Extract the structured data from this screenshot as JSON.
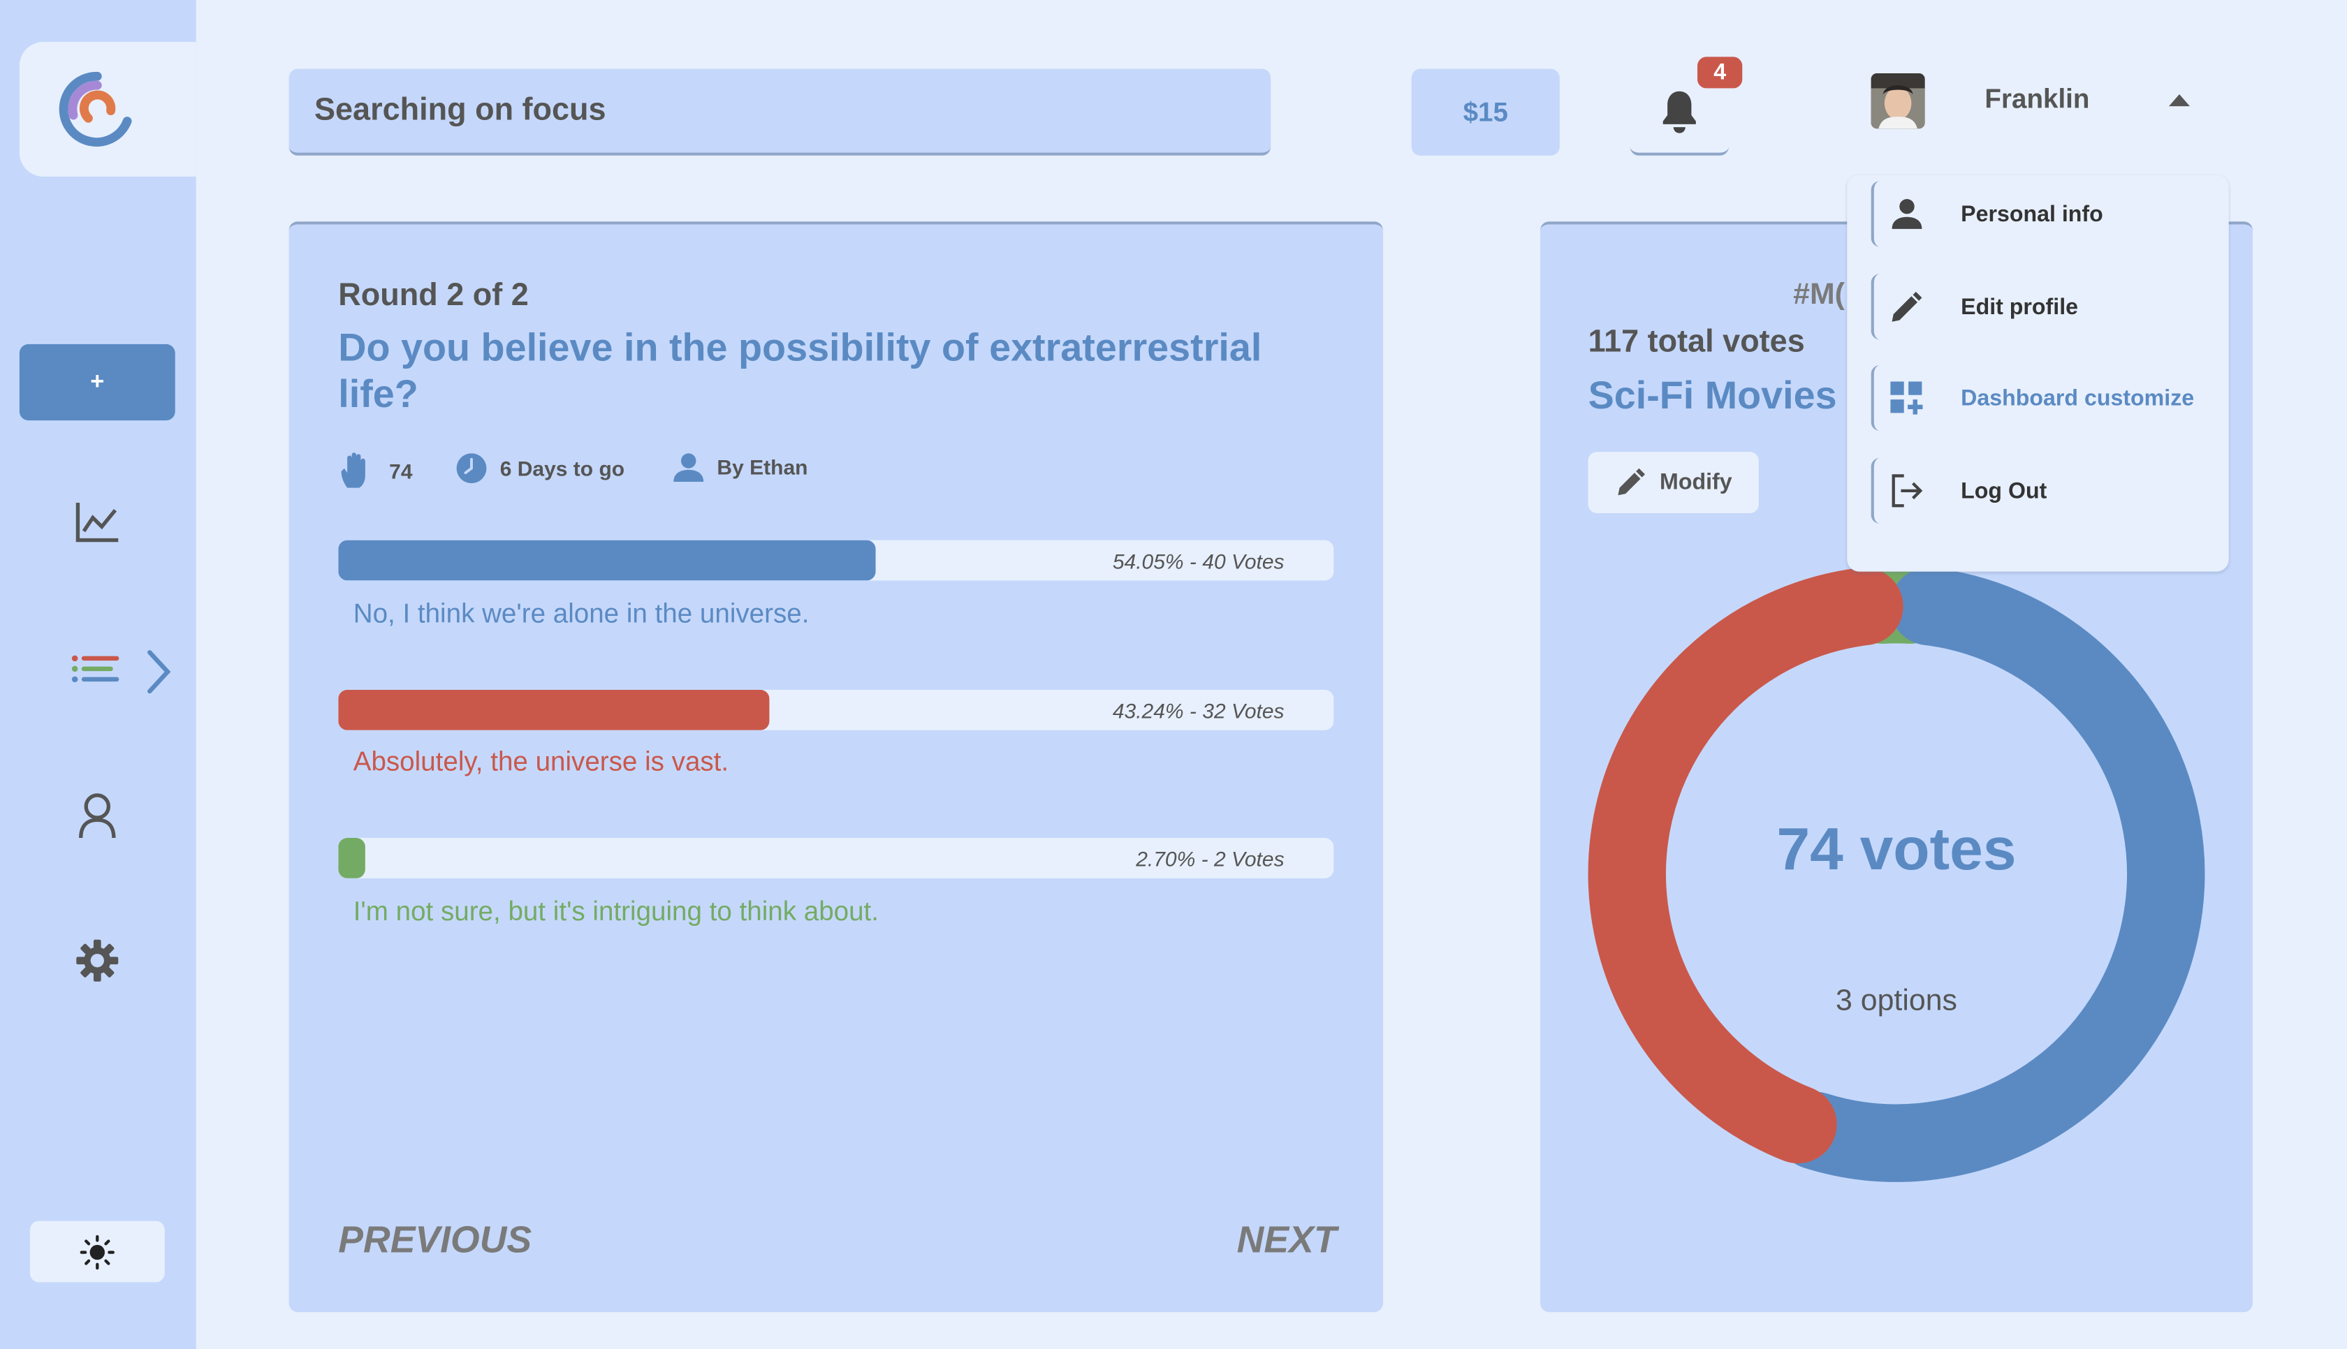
{
  "colors": {
    "accent": "#5b8ac3",
    "red": "#c9584b",
    "green": "#74ab64",
    "panel": "#c5d8fb",
    "background": "#e8f0fd"
  },
  "sidebar": {
    "add_label": "+",
    "items": [
      {
        "icon": "chart-line-icon"
      },
      {
        "icon": "list-icon"
      },
      {
        "icon": "user-icon"
      },
      {
        "icon": "gear-icon"
      }
    ],
    "theme_icon": "sun-icon"
  },
  "header": {
    "search_text": "Searching on focus",
    "balance": "$15",
    "notification_count": "4",
    "user_name": "Franklin"
  },
  "dropdown": {
    "items": [
      {
        "label": "Personal info",
        "icon": "person-icon"
      },
      {
        "label": "Edit profile",
        "icon": "pencil-icon"
      },
      {
        "label": "Dashboard customize",
        "icon": "dashboard-icon"
      },
      {
        "label": "Log Out",
        "icon": "logout-icon"
      }
    ]
  },
  "poll": {
    "round": "Round 2 of 2",
    "question": "Do you believe in the possibility of extraterrestrial life?",
    "participants": "74",
    "time_left": "6 Days to go",
    "author": "By Ethan",
    "options": [
      {
        "label": "No, I think we're alone in the universe.",
        "percent": 54.05,
        "result_text": "54.05% - 40 Votes",
        "color": "#5b8ac3"
      },
      {
        "label": "Absolutely, the universe is vast.",
        "percent": 43.24,
        "result_text": "43.24% - 32 Votes",
        "color": "#c9584b"
      },
      {
        "label": "I'm not sure, but it's intriguing to think about.",
        "percent": 2.7,
        "result_text": "2.70% - 2 Votes",
        "color": "#74ab64"
      }
    ],
    "previous_label": "PREVIOUS",
    "next_label": "NEXT"
  },
  "stats": {
    "hashtag": "#M(",
    "total_votes": "117 total votes",
    "category": "Sci-Fi Movies",
    "modify_label": "Modify",
    "center_votes": "74 votes",
    "center_options": "3 options"
  },
  "chart_data": {
    "type": "pie",
    "categories": [
      "No, I think we're alone in the universe.",
      "Absolutely, the universe is vast.",
      "I'm not sure, but it's intriguing to think about."
    ],
    "values": [
      40,
      32,
      2
    ],
    "colors": [
      "#5b8ac3",
      "#c9584b",
      "#74ab64"
    ],
    "title": ""
  }
}
